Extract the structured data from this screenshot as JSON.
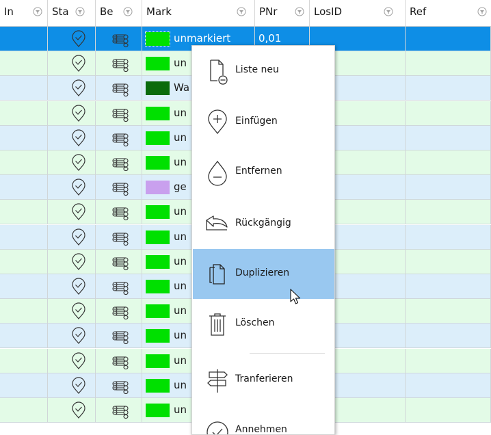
{
  "columns": [
    {
      "id": "in",
      "label": "In"
    },
    {
      "id": "status",
      "label": "Sta"
    },
    {
      "id": "be",
      "label": "Be"
    },
    {
      "id": "mark",
      "label": "Mark"
    },
    {
      "id": "pnr",
      "label": "PNr"
    },
    {
      "id": "losid",
      "label": "LosID"
    },
    {
      "id": "ref",
      "label": "Ref"
    }
  ],
  "rows": [
    {
      "mark_text": "unmarkiert",
      "pnr": "0,01",
      "swatch": "#00e000",
      "bg": "#0e8ee6",
      "selected": true
    },
    {
      "mark_text": "un",
      "pnr": "",
      "swatch": "#00e000",
      "bg": "#e3fbe7"
    },
    {
      "mark_text": "Wa",
      "pnr": "",
      "swatch": "#0b6b0b",
      "bg": "#dceefa"
    },
    {
      "mark_text": "un",
      "pnr": "",
      "swatch": "#00e000",
      "bg": "#e3fbe7"
    },
    {
      "mark_text": "un",
      "pnr": "",
      "swatch": "#00e000",
      "bg": "#dceefa"
    },
    {
      "mark_text": "un",
      "pnr": "",
      "swatch": "#00e000",
      "bg": "#e3fbe7"
    },
    {
      "mark_text": "ge",
      "pnr": "",
      "swatch": "#c9a0ee",
      "bg": "#dceefa"
    },
    {
      "mark_text": "un",
      "pnr": "",
      "swatch": "#00e000",
      "bg": "#e3fbe7"
    },
    {
      "mark_text": "un",
      "pnr": "",
      "swatch": "#00e000",
      "bg": "#dceefa"
    },
    {
      "mark_text": "un",
      "pnr": "",
      "swatch": "#00e000",
      "bg": "#e3fbe7"
    },
    {
      "mark_text": "un",
      "pnr": "",
      "swatch": "#00e000",
      "bg": "#dceefa"
    },
    {
      "mark_text": "un",
      "pnr": "",
      "swatch": "#00e000",
      "bg": "#e3fbe7"
    },
    {
      "mark_text": "un",
      "pnr": "",
      "swatch": "#00e000",
      "bg": "#dceefa"
    },
    {
      "mark_text": "un",
      "pnr": "",
      "swatch": "#00e000",
      "bg": "#e3fbe7"
    },
    {
      "mark_text": "un",
      "pnr": "",
      "swatch": "#00e000",
      "bg": "#dceefa"
    },
    {
      "mark_text": "un",
      "pnr": "",
      "swatch": "#00e000",
      "bg": "#e3fbe7"
    }
  ],
  "row_icons": {
    "status": "location-check-icon",
    "be": "wood-logs-icon"
  },
  "context_menu": {
    "items": [
      {
        "id": "liste-neu",
        "label": "Liste neu",
        "icon": "document-minus-icon"
      },
      {
        "id": "einfuegen",
        "label": "Einfügen",
        "icon": "pin-plus-icon"
      },
      {
        "id": "entfernen",
        "label": "Entfernen",
        "icon": "drop-minus-icon"
      },
      {
        "id": "rueckgaengig",
        "label": "Rückgängig",
        "icon": "undo-arrow-icon"
      },
      {
        "id": "duplizieren",
        "label": "Duplizieren",
        "icon": "copy-documents-icon",
        "highlighted": true
      },
      {
        "id": "loeschen",
        "label": "Löschen",
        "icon": "trash-icon"
      },
      {
        "id": "tranferieren",
        "label": "Tranferieren",
        "icon": "signpost-icon"
      },
      {
        "id": "annehmen",
        "label": "Annehmen",
        "icon": "check-circle-icon"
      }
    ]
  },
  "colors": {
    "selection": "#0e8ee6",
    "row_green": "#e3fbe7",
    "row_blue": "#dceefa",
    "menu_highlight": "#99c8f0"
  }
}
